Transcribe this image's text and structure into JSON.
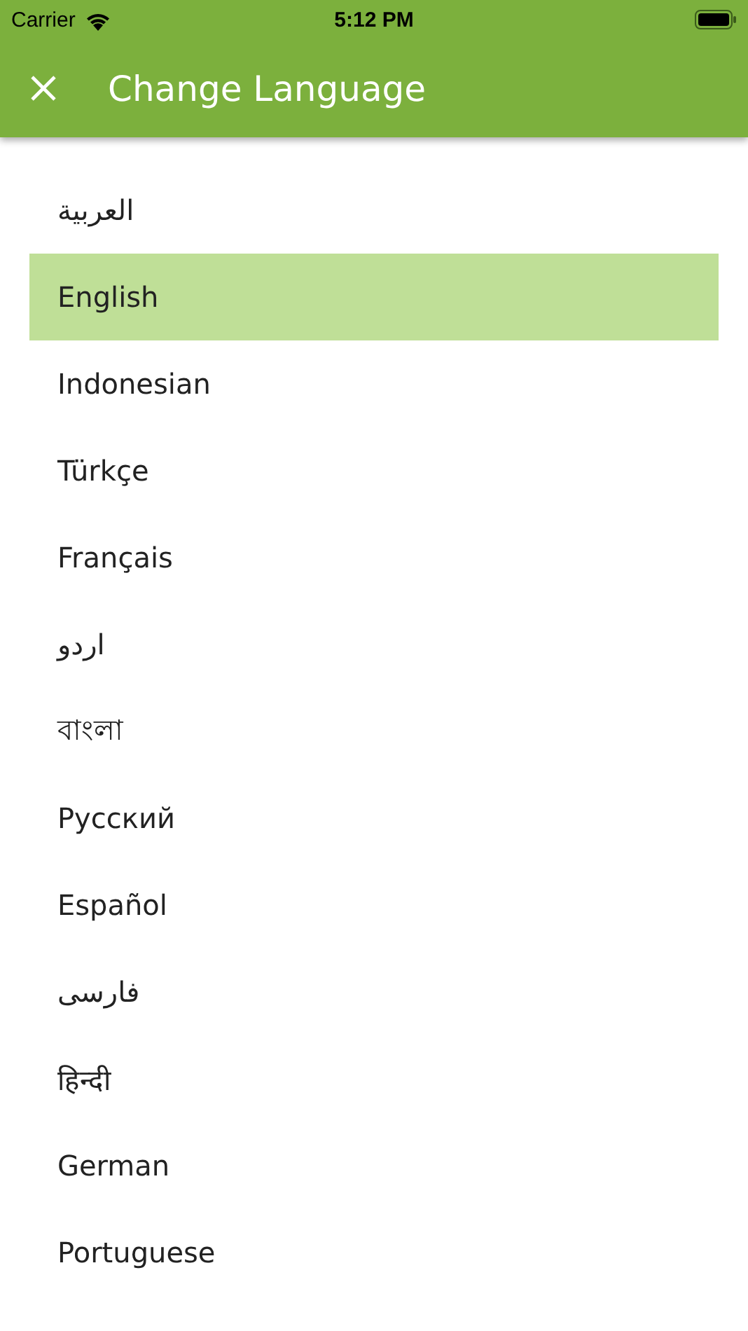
{
  "status_bar": {
    "carrier": "Carrier",
    "time": "5:12 PM"
  },
  "app_bar": {
    "title": "Change Language"
  },
  "languages": [
    {
      "label": "العربية",
      "selected": false
    },
    {
      "label": "English",
      "selected": true
    },
    {
      "label": "Indonesian",
      "selected": false
    },
    {
      "label": "Türkçe",
      "selected": false
    },
    {
      "label": "Français",
      "selected": false
    },
    {
      "label": "اردو",
      "selected": false
    },
    {
      "label": "বাংলা",
      "selected": false
    },
    {
      "label": "Русский",
      "selected": false
    },
    {
      "label": "Español",
      "selected": false
    },
    {
      "label": "فارسی",
      "selected": false
    },
    {
      "label": "हिन्दी",
      "selected": false
    },
    {
      "label": "German",
      "selected": false
    },
    {
      "label": "Portuguese",
      "selected": false
    }
  ]
}
